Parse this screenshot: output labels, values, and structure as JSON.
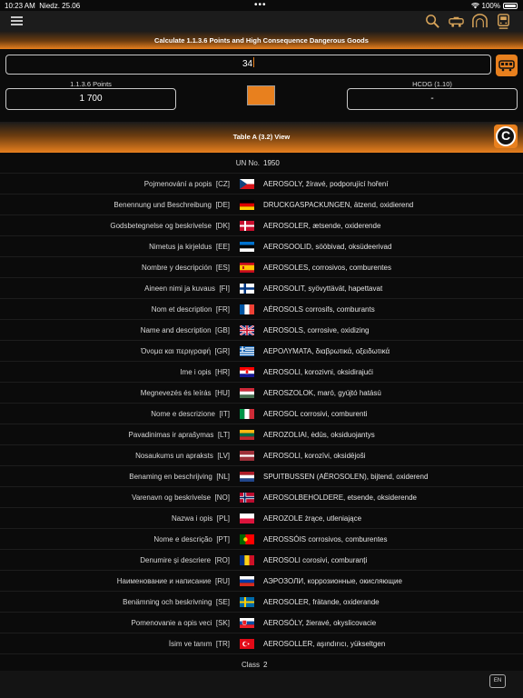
{
  "status": {
    "time": "10:23 AM",
    "date": "Niedz. 25.06",
    "battery": "100%"
  },
  "title": "Calculate 1.1.3.6 Points and High Consequence Dangerous Goods",
  "calculator": {
    "un_value": "34",
    "points_label": "1.1.3.6 Points",
    "points_value": "1 700",
    "hcdg_label": "HCDG (1.10)",
    "hcdg_value": "-",
    "swatch_color": "#e8801e"
  },
  "table_title": "Table A (3.2) View",
  "un_row": {
    "label": "UN No.",
    "value": "1950"
  },
  "rows": [
    {
      "label": "Pojmenování a popis",
      "code": "[CZ]",
      "value": "AEROSOLY, žíravé, podporující hoření"
    },
    {
      "label": "Benennung und Beschreibung",
      "code": "[DE]",
      "value": "DRUCKGASPACKUNGEN, ätzend, oxidierend"
    },
    {
      "label": "Godsbetegnelse og beskrivelse",
      "code": "[DK]",
      "value": "AEROSOLER, ætsende, oxiderende"
    },
    {
      "label": "Nimetus ja kirjeldus",
      "code": "[EE]",
      "value": "AEROSOOLID, sööbivad, oksüdeerivad"
    },
    {
      "label": "Nombre y descripción",
      "code": "[ES]",
      "value": "AEROSOLES, corrosivos, comburentes"
    },
    {
      "label": "Aineen nimi ja kuvaus",
      "code": "[FI]",
      "value": "AEROSOLIT, syövyttävät, hapettavat"
    },
    {
      "label": "Nom et description",
      "code": "[FR]",
      "value": "AÉROSOLS corrosifs, comburants"
    },
    {
      "label": "Name and description",
      "code": "[GB]",
      "value": "AEROSOLS, corrosive, oxidizing"
    },
    {
      "label": "Όνομα και περιγραφή",
      "code": "[GR]",
      "value": "ΑΕΡΟΛΥΜΑΤΑ, διαβρωτικά, οξειδωτικά"
    },
    {
      "label": "Ime i opis",
      "code": "[HR]",
      "value": "AEROSOLI, korozivni, oksidirajući"
    },
    {
      "label": "Megnevezés és leírás",
      "code": "[HU]",
      "value": "AEROSZOLOK, maró, gyújtó hatású"
    },
    {
      "label": "Nome e descrizione",
      "code": "[IT]",
      "value": "AEROSOL corrosivi, comburenti"
    },
    {
      "label": "Pavadinimas ir aprašymas",
      "code": "[LT]",
      "value": "AEROZOLIAI, ėdūs, oksiduojantys"
    },
    {
      "label": "Nosaukums un apraksts",
      "code": "[LV]",
      "value": "AEROSOLI, korozīvi, oksidējoši"
    },
    {
      "label": "Benaming en beschrijving",
      "code": "[NL]",
      "value": "SPUITBUSSEN (AËROSOLEN), bijtend, oxiderend"
    },
    {
      "label": "Varenavn og beskrivelse",
      "code": "[NO]",
      "value": "AEROSOLBEHOLDERE, etsende, oksiderende"
    },
    {
      "label": "Nazwa i opis",
      "code": "[PL]",
      "value": "AEROZOLE żrące, utleniające"
    },
    {
      "label": "Nome e descrição",
      "code": "[PT]",
      "value": "AEROSSÓIS corrosivos, comburentes"
    },
    {
      "label": "Denumire și descriere",
      "code": "[RO]",
      "value": "AEROSOLI corosivi, comburanți"
    },
    {
      "label": "Наименование и написание",
      "code": "[RU]",
      "value": "АЭРОЗОЛИ, коррозионные, окисляющие"
    },
    {
      "label": "Benämning och beskrivning",
      "code": "[SE]",
      "value": "AEROSOLER, frätande, oxiderande"
    },
    {
      "label": "Pomenovanie a opis veci",
      "code": "[SK]",
      "value": "AEROSÓLY, žieravé, okyslicovacie"
    },
    {
      "label": "İsim ve tanım",
      "code": "[TR]",
      "value": "AEROSOLLER, aşındırıcı, yükseltgen"
    }
  ],
  "class_row": {
    "label": "Class",
    "value": "2"
  },
  "lang_button": "EN",
  "colors": {
    "accent": "#e8801e",
    "background": "#0b0b0b"
  }
}
